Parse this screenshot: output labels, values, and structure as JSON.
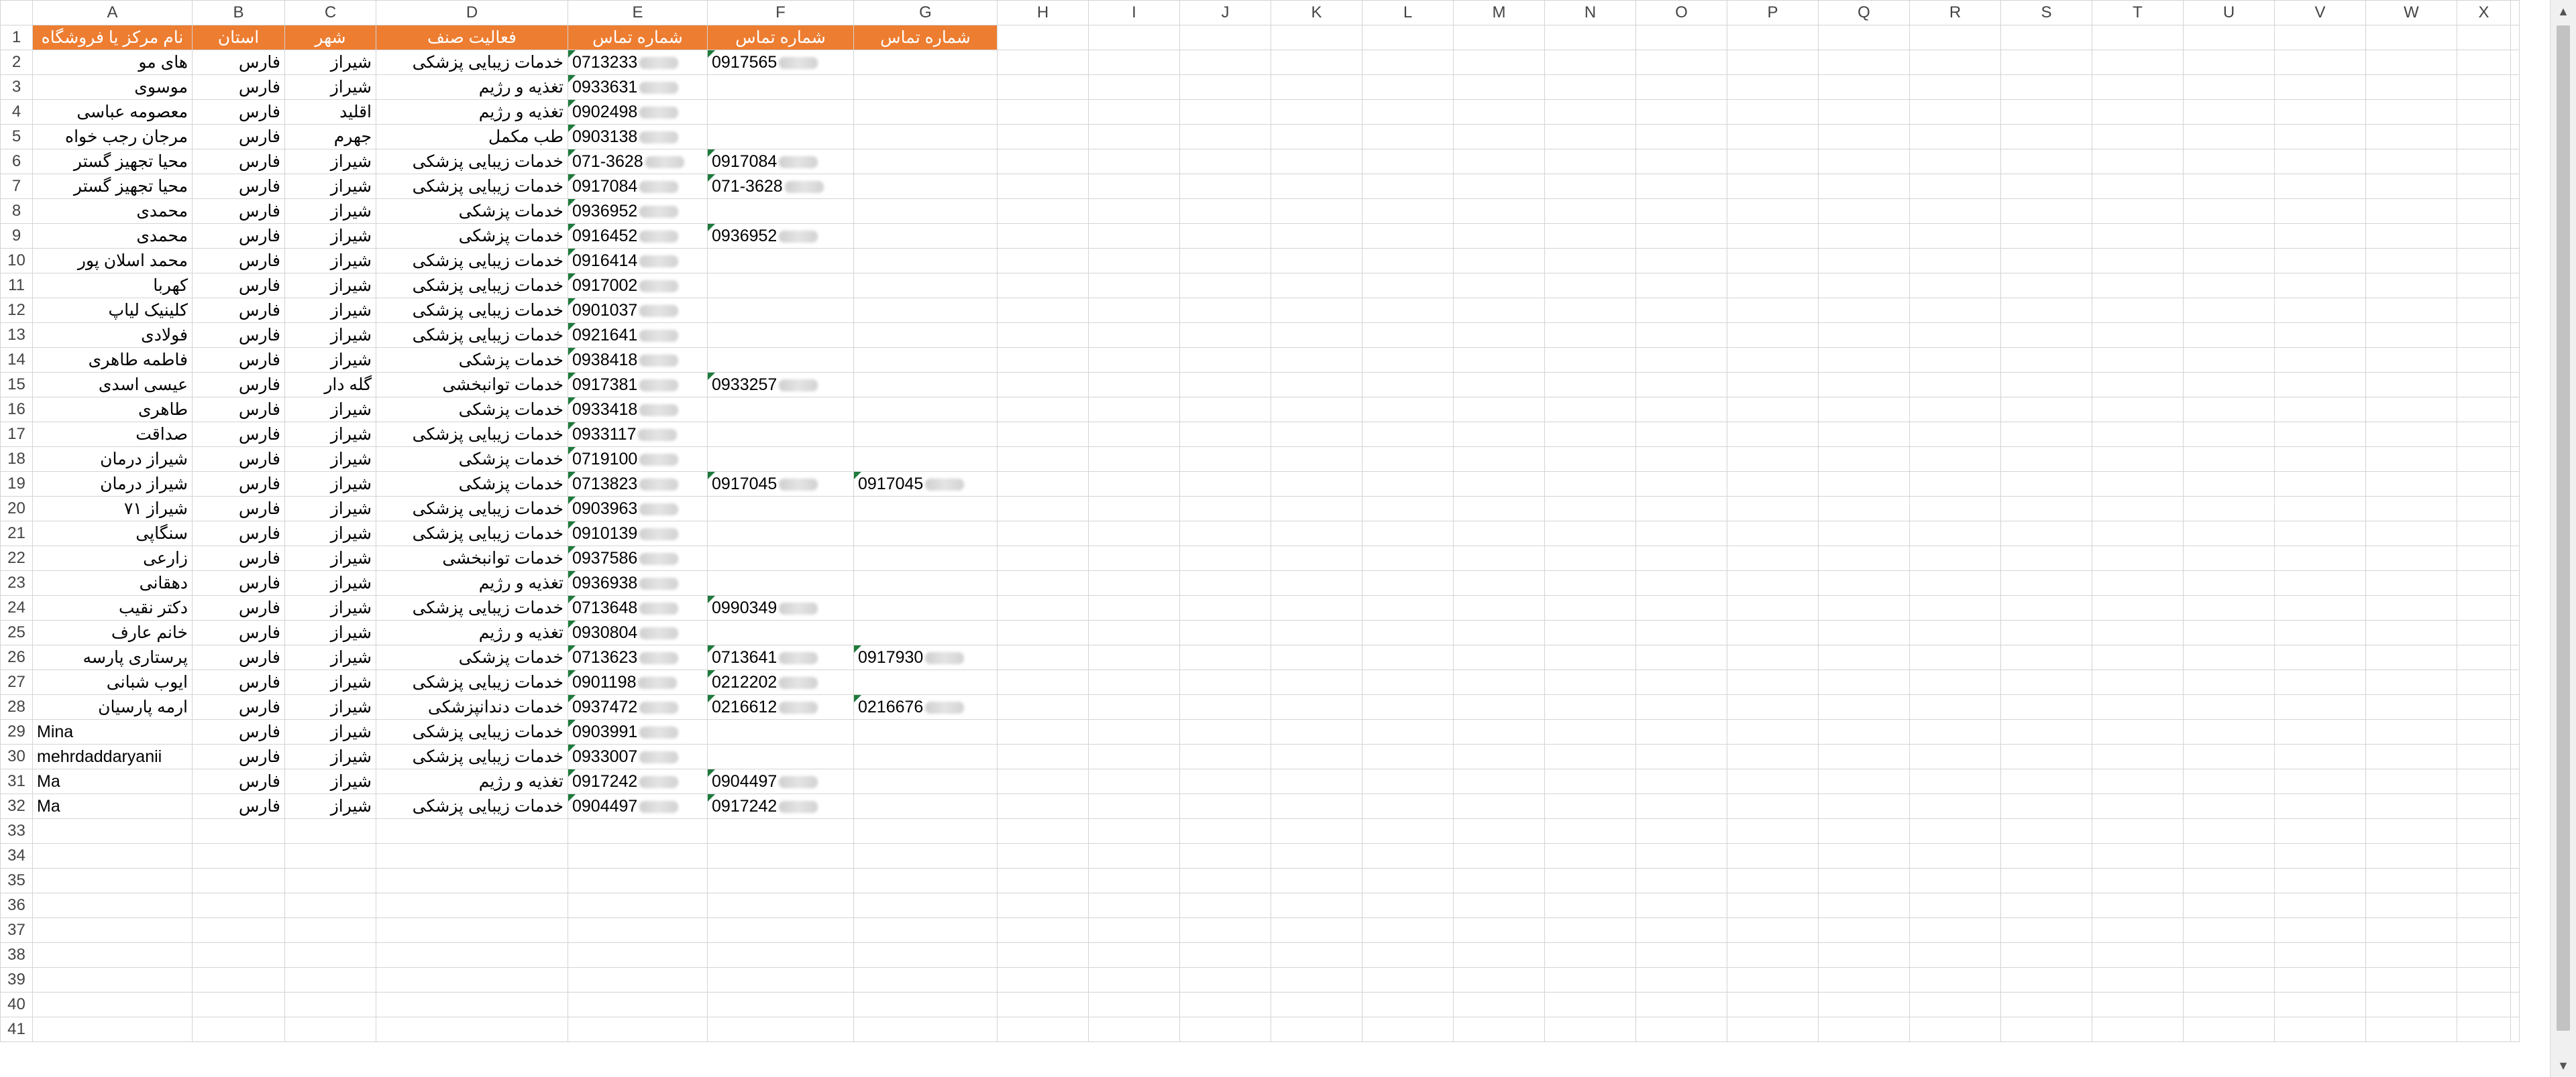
{
  "columns": [
    "A",
    "B",
    "C",
    "D",
    "E",
    "F",
    "G",
    "H",
    "I",
    "J",
    "K",
    "L",
    "M",
    "N",
    "O",
    "P",
    "Q",
    "R",
    "S",
    "T",
    "U",
    "V",
    "W",
    "X"
  ],
  "header": [
    "نام مرکز یا فروشگاه",
    "استان",
    "شهر",
    "فعالیت صنف",
    "شماره تماس",
    "شماره تماس",
    "شماره تماس"
  ],
  "rows": [
    {
      "a": "های مو",
      "b": "فارس",
      "c": "شیراز",
      "d": "خدمات زیبایی پزشکی",
      "e": "0713233",
      "f": "0917565",
      "g": ""
    },
    {
      "a": "موسوی",
      "b": "فارس",
      "c": "شیراز",
      "d": "تغذیه و رژیم",
      "e": "0933631",
      "f": "",
      "g": ""
    },
    {
      "a": "معصومه عباسی",
      "b": "فارس",
      "c": "اقلید",
      "d": "تغذیه و رژیم",
      "e": "0902498",
      "f": "",
      "g": ""
    },
    {
      "a": "مرجان رجب خواه",
      "b": "فارس",
      "c": "جهرم",
      "d": "طب مکمل",
      "e": "0903138",
      "f": "",
      "g": ""
    },
    {
      "a": "محیا تجهیز گستر",
      "b": "فارس",
      "c": "شیراز",
      "d": "خدمات زیبایی پزشکی",
      "e": "071-3628",
      "f": "0917084",
      "g": ""
    },
    {
      "a": "محیا تجهیز گستر",
      "b": "فارس",
      "c": "شیراز",
      "d": "خدمات زیبایی پزشکی",
      "e": "0917084",
      "f": "071-3628",
      "g": ""
    },
    {
      "a": "محمدی",
      "b": "فارس",
      "c": "شیراز",
      "d": "خدمات پزشکی",
      "e": "0936952",
      "f": "",
      "g": ""
    },
    {
      "a": "محمدی",
      "b": "فارس",
      "c": "شیراز",
      "d": "خدمات پزشکی",
      "e": "0916452",
      "f": "0936952",
      "g": ""
    },
    {
      "a": "محمد اسلان پور",
      "b": "فارس",
      "c": "شیراز",
      "d": "خدمات زیبایی پزشکی",
      "e": "0916414",
      "f": "",
      "g": ""
    },
    {
      "a": "کهربا",
      "b": "فارس",
      "c": "شیراز",
      "d": "خدمات زیبایی پزشکی",
      "e": "0917002",
      "f": "",
      "g": ""
    },
    {
      "a": "کلینیک لیاپ",
      "b": "فارس",
      "c": "شیراز",
      "d": "خدمات زیبایی پزشکی",
      "e": "0901037",
      "f": "",
      "g": ""
    },
    {
      "a": "فولادی",
      "b": "فارس",
      "c": "شیراز",
      "d": "خدمات زیبایی پزشکی",
      "e": "0921641",
      "f": "",
      "g": ""
    },
    {
      "a": "فاطمه طاهری",
      "b": "فارس",
      "c": "شیراز",
      "d": "خدمات پزشکی",
      "e": "0938418",
      "f": "",
      "g": ""
    },
    {
      "a": "عیسی اسدی",
      "b": "فارس",
      "c": "گله دار",
      "d": "خدمات توانبخشی",
      "e": "0917381",
      "f": "0933257",
      "g": ""
    },
    {
      "a": "طاهری",
      "b": "فارس",
      "c": "شیراز",
      "d": "خدمات پزشکی",
      "e": "0933418",
      "f": "",
      "g": ""
    },
    {
      "a": "صداقت",
      "b": "فارس",
      "c": "شیراز",
      "d": "خدمات زیبایی پزشکی",
      "e": "0933117",
      "f": "",
      "g": ""
    },
    {
      "a": "شیراز درمان",
      "b": "فارس",
      "c": "شیراز",
      "d": "خدمات پزشکی",
      "e": "0719100",
      "f": "",
      "g": ""
    },
    {
      "a": "شیراز درمان",
      "b": "فارس",
      "c": "شیراز",
      "d": "خدمات پزشکی",
      "e": "0713823",
      "f": "0917045",
      "g": "0917045"
    },
    {
      "a": "شیراز ۷۱",
      "b": "فارس",
      "c": "شیراز",
      "d": "خدمات زیبایی پزشکی",
      "e": "0903963",
      "f": "",
      "g": ""
    },
    {
      "a": "سنگاپی",
      "b": "فارس",
      "c": "شیراز",
      "d": "خدمات زیبایی پزشکی",
      "e": "0910139",
      "f": "",
      "g": ""
    },
    {
      "a": "زارعی",
      "b": "فارس",
      "c": "شیراز",
      "d": "خدمات توانبخشی",
      "e": "0937586",
      "f": "",
      "g": ""
    },
    {
      "a": "دهقانی",
      "b": "فارس",
      "c": "شیراز",
      "d": "تغذیه و رژیم",
      "e": "0936938",
      "f": "",
      "g": ""
    },
    {
      "a": "دکتر نقیب",
      "b": "فارس",
      "c": "شیراز",
      "d": "خدمات زیبایی پزشکی",
      "e": "0713648",
      "f": "0990349",
      "g": ""
    },
    {
      "a": "خانم عارف",
      "b": "فارس",
      "c": "شیراز",
      "d": "تغذیه و رژیم",
      "e": "0930804",
      "f": "",
      "g": ""
    },
    {
      "a": "پرستاری پارسه",
      "b": "فارس",
      "c": "شیراز",
      "d": "خدمات پزشکی",
      "e": "0713623",
      "f": "0713641",
      "g": "0917930"
    },
    {
      "a": "ایوب شبانی",
      "b": "فارس",
      "c": "شیراز",
      "d": "خدمات زیبایی پزشکی",
      "e": "0901198",
      "f": "0212202",
      "g": ""
    },
    {
      "a": "ارمه پارسیان",
      "b": "فارس",
      "c": "شیراز",
      "d": "خدمات دندانپزشکی",
      "e": "0937472",
      "f": "0216612",
      "g": "0216676"
    },
    {
      "a": "Mina",
      "b": "فارس",
      "c": "شیراز",
      "d": "خدمات زیبایی پزشکی",
      "e": "0903991",
      "f": "",
      "g": ""
    },
    {
      "a": "mehrdaddaryanii",
      "b": "فارس",
      "c": "شیراز",
      "d": "خدمات زیبایی پزشکی",
      "e": "0933007",
      "f": "",
      "g": ""
    },
    {
      "a": "Ma",
      "b": "فارس",
      "c": "شیراز",
      "d": "تغذیه و رژیم",
      "e": "0917242",
      "f": "0904497",
      "g": ""
    },
    {
      "a": "Ma",
      "b": "فارس",
      "c": "شیراز",
      "d": "خدمات زیبایی پزشکی",
      "e": "0904497",
      "f": "0917242",
      "g": ""
    }
  ],
  "empty_row_numbers": [
    33,
    34,
    35,
    36,
    37,
    38,
    39,
    40,
    41
  ],
  "colors": {
    "header_fill": "#ed7d31",
    "header_text": "#ffffff",
    "comment_marker": "#1e7a3c",
    "grid": "#d4d4d4"
  }
}
